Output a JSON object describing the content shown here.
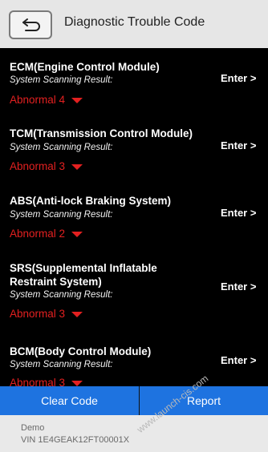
{
  "header": {
    "title": "Diagnostic Trouble Code",
    "back_icon": "return-arrow-icon"
  },
  "modules": [
    {
      "name": "ECM(Engine Control Module)",
      "scan_label": "System Scanning Result:",
      "result": "Abnormal 4",
      "enter": "Enter >"
    },
    {
      "name": "TCM(Transmission Control Module)",
      "scan_label": "System Scanning Result:",
      "result": "Abnormal 3",
      "enter": "Enter >"
    },
    {
      "name": "ABS(Anti-lock Braking System)",
      "scan_label": "System Scanning Result:",
      "result": "Abnormal 2",
      "enter": "Enter >"
    },
    {
      "name": "SRS(Supplemental Inflatable Restraint System)",
      "scan_label": "System Scanning Result:",
      "result": "Abnormal 3",
      "enter": "Enter >"
    },
    {
      "name": "BCM(Body Control Module)",
      "scan_label": "System Scanning Result:",
      "result": "Abnormal 3",
      "enter": "Enter >"
    }
  ],
  "footer": {
    "clear_code": "Clear Code",
    "report": "Report"
  },
  "status": {
    "mode": "Demo",
    "vin": "VIN 1E4GEAK12FT00001X"
  },
  "watermark": "www.launch-cis.com",
  "colors": {
    "background": "#000000",
    "abnormal": "#e32020",
    "button_bar": "#1e73e0",
    "header": "#e6e6e6"
  }
}
